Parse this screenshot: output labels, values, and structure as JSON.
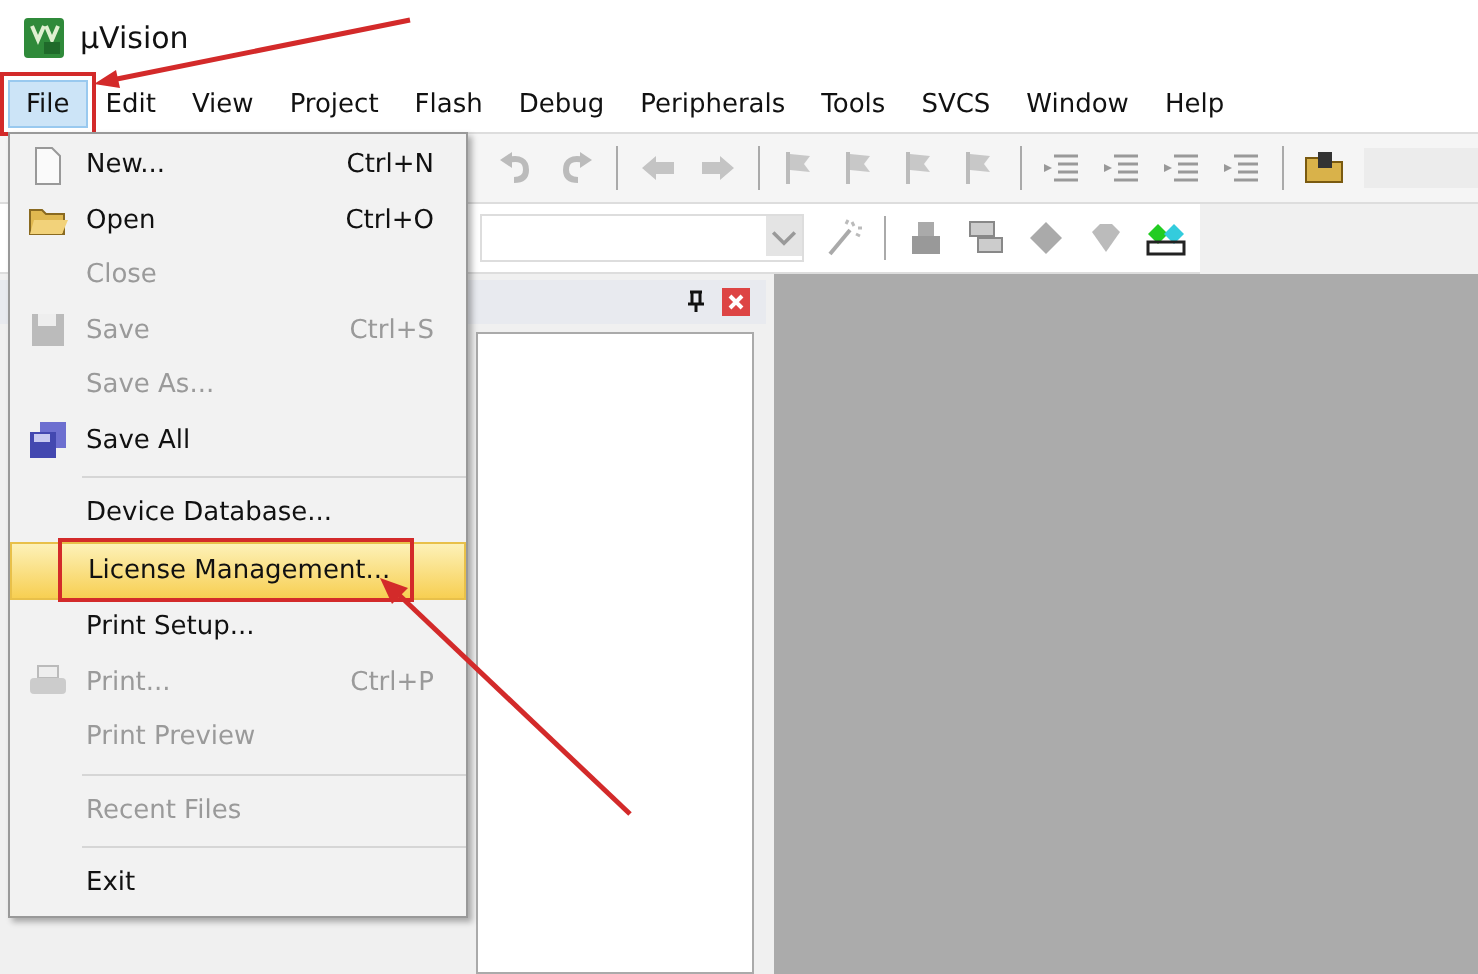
{
  "window": {
    "title": "µVision"
  },
  "menubar": [
    {
      "label": "File",
      "selected": true,
      "annotated": true
    },
    {
      "label": "Edit",
      "selected": false,
      "annotated": false
    },
    {
      "label": "View",
      "selected": false,
      "annotated": false
    },
    {
      "label": "Project",
      "selected": false,
      "annotated": false
    },
    {
      "label": "Flash",
      "selected": false,
      "annotated": false
    },
    {
      "label": "Debug",
      "selected": false,
      "annotated": false
    },
    {
      "label": "Peripherals",
      "selected": false,
      "annotated": false
    },
    {
      "label": "Tools",
      "selected": false,
      "annotated": false
    },
    {
      "label": "SVCS",
      "selected": false,
      "annotated": false
    },
    {
      "label": "Window",
      "selected": false,
      "annotated": false
    },
    {
      "label": "Help",
      "selected": false,
      "annotated": false
    }
  ],
  "file_menu": [
    {
      "kind": "item",
      "label": "New...",
      "shortcut": "Ctrl+N",
      "disabled": false,
      "selected": false,
      "annotated": false
    },
    {
      "kind": "item",
      "label": "Open",
      "shortcut": "Ctrl+O",
      "disabled": false,
      "selected": false,
      "annotated": false
    },
    {
      "kind": "item",
      "label": "Close",
      "disabled": true,
      "selected": false,
      "annotated": false
    },
    {
      "kind": "item",
      "label": "Save",
      "shortcut": "Ctrl+S",
      "disabled": true,
      "selected": false,
      "annotated": false
    },
    {
      "kind": "item",
      "label": "Save As...",
      "disabled": true,
      "selected": false,
      "annotated": false
    },
    {
      "kind": "item",
      "label": "Save All",
      "disabled": false,
      "selected": false,
      "annotated": false
    },
    {
      "kind": "separator"
    },
    {
      "kind": "item",
      "label": "Device Database...",
      "disabled": false,
      "selected": false,
      "annotated": false
    },
    {
      "kind": "item",
      "label": "License Management...",
      "disabled": false,
      "selected": true,
      "annotated": true
    },
    {
      "kind": "item",
      "label": "Print Setup...",
      "disabled": false,
      "selected": false,
      "annotated": false
    },
    {
      "kind": "item",
      "label": "Print...",
      "shortcut": "Ctrl+P",
      "disabled": true,
      "selected": false,
      "annotated": false
    },
    {
      "kind": "item",
      "label": "Print Preview",
      "disabled": true,
      "selected": false,
      "annotated": false
    },
    {
      "kind": "separator"
    },
    {
      "kind": "item",
      "label": "Recent Files",
      "disabled": true,
      "selected": false,
      "annotated": false
    },
    {
      "kind": "separator"
    },
    {
      "kind": "item",
      "label": "Exit",
      "disabled": false,
      "selected": false,
      "annotated": false
    }
  ]
}
